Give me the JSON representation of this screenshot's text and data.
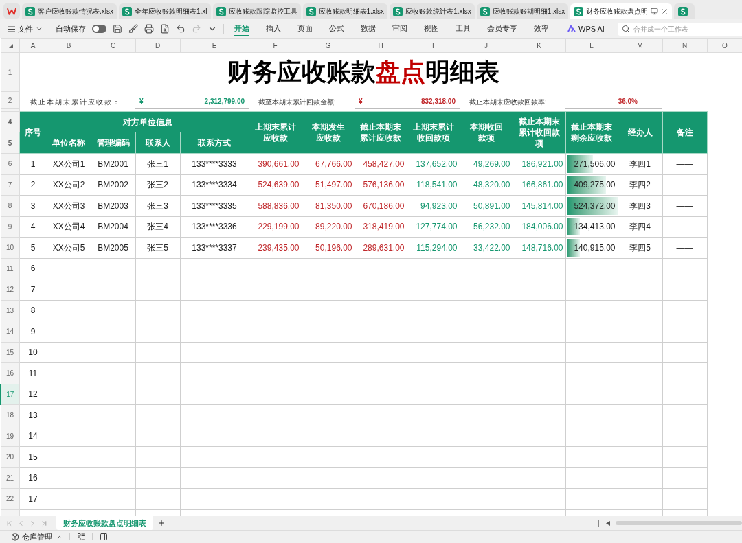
{
  "file_tabs": [
    {
      "label": "客户应收账款情况表.xlsx",
      "selected": false
    },
    {
      "label": "全年应收账款明细表1.xl",
      "selected": false
    },
    {
      "label": "应收账款跟踪监控工具",
      "selected": false
    },
    {
      "label": "应收账款明细表1.xlsx",
      "selected": false
    },
    {
      "label": "应收账款统计表1.xlsx",
      "selected": false
    },
    {
      "label": "应收账款账期明细1.xlsx",
      "selected": false
    },
    {
      "label": "财务应收账款盘点明",
      "selected": true
    }
  ],
  "toolbar": {
    "file_menu": "文件",
    "autosave": {
      "label": "自动保存",
      "on": false
    },
    "ribbon_tabs": [
      {
        "label": "开始",
        "selected": true
      },
      {
        "label": "插入",
        "selected": false
      },
      {
        "label": "页面",
        "selected": false
      },
      {
        "label": "公式",
        "selected": false
      },
      {
        "label": "数据",
        "selected": false
      },
      {
        "label": "审阅",
        "selected": false
      },
      {
        "label": "视图",
        "selected": false
      },
      {
        "label": "工具",
        "selected": false
      },
      {
        "label": "会员专享",
        "selected": false
      },
      {
        "label": "效率",
        "selected": false
      }
    ],
    "ai_button": "WPS AI",
    "search": {
      "placeholder": "合并成一个工作表"
    }
  },
  "sheet": {
    "column_letters": [
      "A",
      "B",
      "C",
      "D",
      "E",
      "F",
      "G",
      "H",
      "I",
      "J",
      "K",
      "L",
      "M",
      "N",
      "O"
    ],
    "row_numbers": [
      {
        "label": "1",
        "selected": false
      },
      {
        "label": "2",
        "selected": false
      },
      {
        "label": "4",
        "selected": false
      },
      {
        "label": "5",
        "selected": false
      },
      {
        "label": "6",
        "selected": false
      },
      {
        "label": "7",
        "selected": false
      },
      {
        "label": "8",
        "selected": false
      },
      {
        "label": "9",
        "selected": false
      },
      {
        "label": "10",
        "selected": false
      },
      {
        "label": "11",
        "selected": false
      },
      {
        "label": "12",
        "selected": false
      },
      {
        "label": "13",
        "selected": false
      },
      {
        "label": "14",
        "selected": false
      },
      {
        "label": "15",
        "selected": false
      },
      {
        "label": "16",
        "selected": false
      },
      {
        "label": "17",
        "selected": true
      },
      {
        "label": "18",
        "selected": false
      },
      {
        "label": "19",
        "selected": false
      },
      {
        "label": "20",
        "selected": false
      },
      {
        "label": "21",
        "selected": false
      },
      {
        "label": "22",
        "selected": false
      }
    ],
    "title": {
      "before": "财务应收账款",
      "highlight": "盘点",
      "after": "明细表"
    },
    "summary": [
      {
        "label": "截止本期末累计应收款：",
        "currency": "¥",
        "value": "2,312,799.00",
        "color": "#15976f"
      },
      {
        "label": "截至本期末累计回款金额:",
        "currency": "¥",
        "value": "832,318.00",
        "color": "#c0282b"
      },
      {
        "label": "截止本期末应收款回款率:",
        "value": "36.0%",
        "color": "#c0282b"
      }
    ],
    "header": {
      "seq": "序号",
      "group": "对方单位信息",
      "group_columns": [
        "单位名称",
        "管理编码",
        "联系人",
        "联系方式"
      ],
      "columns": [
        [
          "上期末累计",
          "应收款"
        ],
        [
          "本期发生",
          "应收款"
        ],
        [
          "截止本期末",
          "累计应收款"
        ],
        [
          "上期末累计",
          "收回款项"
        ],
        [
          "本期收回",
          "款项"
        ],
        [
          "截止本期末",
          "累计收回款",
          "项"
        ],
        [
          "截止本期末",
          "剩余应收款"
        ],
        [
          "经办人"
        ],
        [
          "备注"
        ]
      ]
    },
    "rows": [
      {
        "seq": "1",
        "unit": "XX公司1",
        "code": "BM2001",
        "contact": "张三1",
        "phone": "133****3333",
        "prev_due": "390,661.00",
        "cur_due": "67,766.00",
        "total_due": "458,427.00",
        "prev_paid": "137,652.00",
        "cur_paid": "49,269.00",
        "total_paid": "186,921.00",
        "remaining": {
          "value": "271,506.00",
          "level": 0.52
        },
        "handler": "李四1",
        "note": "——"
      },
      {
        "seq": "2",
        "unit": "XX公司2",
        "code": "BM2002",
        "contact": "张三2",
        "phone": "133****3334",
        "prev_due": "524,639.00",
        "cur_due": "51,497.00",
        "total_due": "576,136.00",
        "prev_paid": "118,541.00",
        "cur_paid": "48,320.00",
        "total_paid": "166,861.00",
        "remaining": {
          "value": "409,275.00",
          "level": 0.78
        },
        "handler": "李四2",
        "note": "——"
      },
      {
        "seq": "3",
        "unit": "XX公司3",
        "code": "BM2003",
        "contact": "张三3",
        "phone": "133****3335",
        "prev_due": "588,836.00",
        "cur_due": "81,350.00",
        "total_due": "670,186.00",
        "prev_paid": "94,923.00",
        "cur_paid": "50,891.00",
        "total_paid": "145,814.00",
        "remaining": {
          "value": "524,372.00",
          "level": 1.0
        },
        "handler": "李四3",
        "note": "——"
      },
      {
        "seq": "4",
        "unit": "XX公司4",
        "code": "BM2004",
        "contact": "张三4",
        "phone": "133****3336",
        "prev_due": "229,199.00",
        "cur_due": "89,220.00",
        "total_due": "318,419.00",
        "prev_paid": "127,774.00",
        "cur_paid": "56,232.00",
        "total_paid": "184,006.00",
        "remaining": {
          "value": "134,413.00",
          "level": 0.26
        },
        "handler": "李四4",
        "note": "——"
      },
      {
        "seq": "5",
        "unit": "XX公司5",
        "code": "BM2005",
        "contact": "张三5",
        "phone": "133****3337",
        "prev_due": "239,435.00",
        "cur_due": "50,196.00",
        "total_due": "289,631.00",
        "prev_paid": "115,294.00",
        "cur_paid": "33,422.00",
        "total_paid": "148,716.00",
        "remaining": {
          "value": "140,915.00",
          "level": 0.27
        },
        "handler": "李四5",
        "note": "——"
      },
      {
        "seq": "6"
      },
      {
        "seq": "7"
      },
      {
        "seq": "8"
      },
      {
        "seq": "9"
      },
      {
        "seq": "10"
      },
      {
        "seq": "11"
      },
      {
        "seq": "12"
      },
      {
        "seq": "13"
      },
      {
        "seq": "14"
      },
      {
        "seq": "15"
      },
      {
        "seq": "16"
      },
      {
        "seq": "17"
      }
    ]
  },
  "sheet_tabs": [
    {
      "label": "财务应收账款盘点明细表",
      "selected": true
    }
  ],
  "status_bar": {
    "warehouse": "仓库管理"
  }
}
